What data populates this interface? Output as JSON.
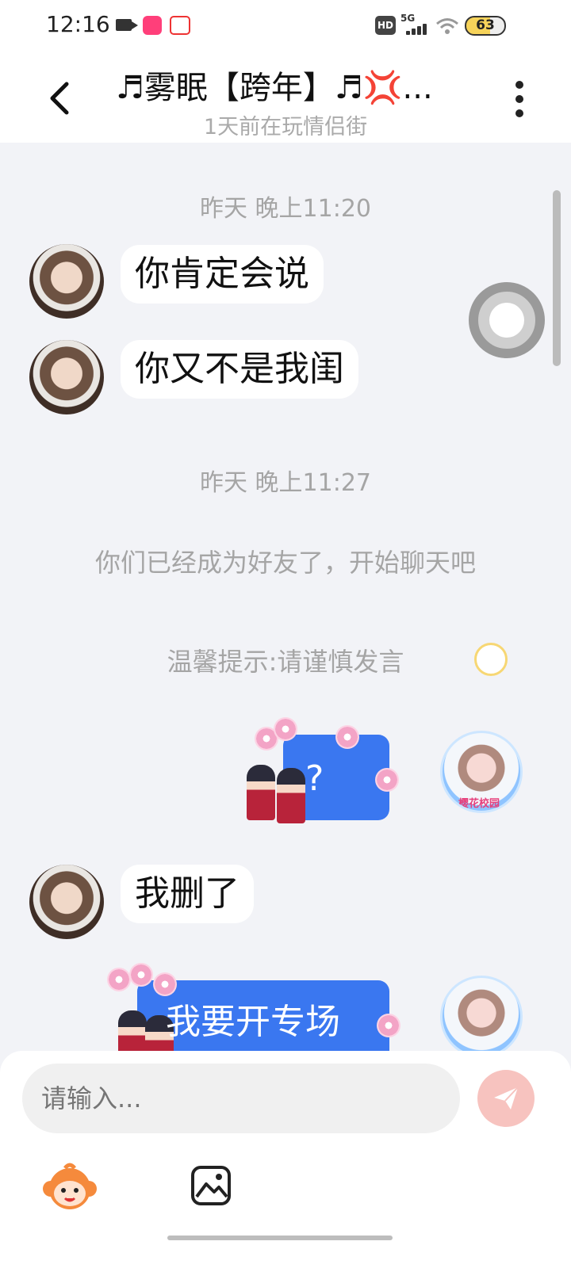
{
  "status_bar": {
    "time": "12:16",
    "network": "5G",
    "hd": "HD",
    "battery": "63"
  },
  "header": {
    "title": "♬雾眠【跨年】♬💢...",
    "subtitle": "1天前在玩情侣街"
  },
  "chat": {
    "timestamps": [
      "昨天 晚上11:20",
      "昨天 晚上11:27"
    ],
    "messages": [
      {
        "from": "other",
        "text": "你肯定会说"
      },
      {
        "from": "other",
        "text": "你又不是我闺"
      },
      {
        "from": "other",
        "text": "我删了"
      }
    ],
    "system": {
      "friend_notice": "你们已经成为好友了，开始聊天吧",
      "warning": "温馨提示:请谨慎发言"
    },
    "stickers": [
      {
        "from": "me",
        "text": "?"
      },
      {
        "from": "me",
        "text": "我要开专场"
      }
    ],
    "my_avatar_badge": "樱花校园"
  },
  "input": {
    "placeholder": "请输入..."
  },
  "colors": {
    "accent_blue": "#3a77f0",
    "send_button": "#f7c3bf"
  }
}
